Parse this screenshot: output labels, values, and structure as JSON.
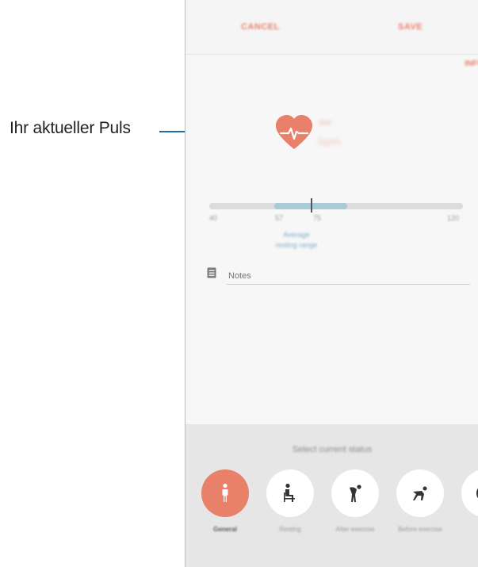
{
  "callout": {
    "label": "Ihr aktueller Puls"
  },
  "topbar": {
    "cancel_label": "CANCEL",
    "save_label": "SAVE"
  },
  "info_link": "INFO",
  "heart_rate": {
    "value": "--",
    "unit": "bpm",
    "sub": ""
  },
  "range_bar": {
    "ticks": [
      "40",
      "57",
      "75",
      "120"
    ],
    "caption_line1": "Average",
    "caption_line2": "resting range"
  },
  "notes": {
    "placeholder": "Notes"
  },
  "status_panel": {
    "title": "Select current status",
    "options": [
      {
        "label": "General",
        "icon": "person-standing-icon",
        "selected": true
      },
      {
        "label": "Resting",
        "icon": "person-sitting-icon",
        "selected": false
      },
      {
        "label": "After exercise",
        "icon": "person-bent-icon",
        "selected": false
      },
      {
        "label": "Before exercise",
        "icon": "person-crouching-icon",
        "selected": false
      },
      {
        "label": "",
        "icon": "partial-status-icon",
        "selected": false
      }
    ]
  },
  "colors": {
    "accent": "#e8806a",
    "callout_line": "#1e6fa8",
    "range_fill": "#a9cbd8"
  }
}
